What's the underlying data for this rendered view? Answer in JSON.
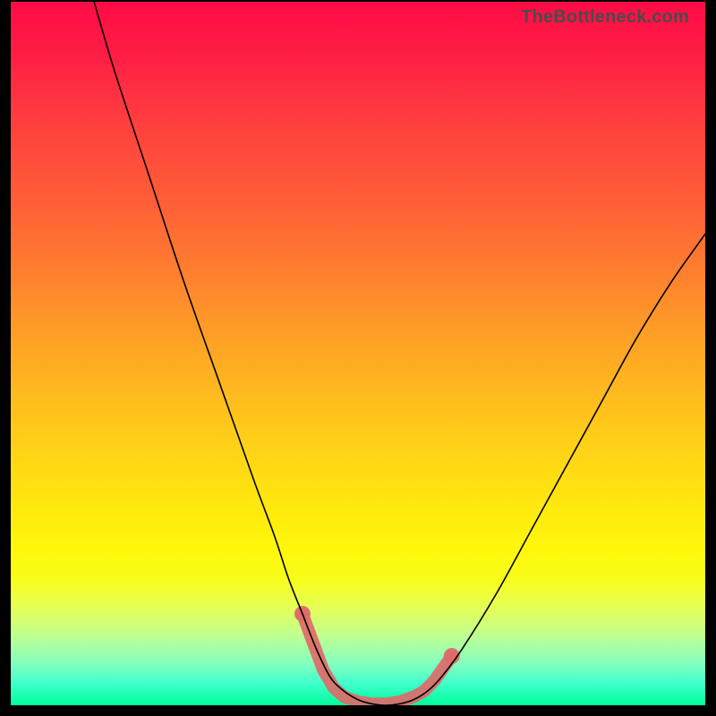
{
  "watermark": "TheBottleneck.com",
  "chart_data": {
    "type": "line",
    "title": "",
    "xlabel": "",
    "ylabel": "",
    "xlim": [
      0,
      100
    ],
    "ylim": [
      0,
      100
    ],
    "grid": false,
    "legend": false,
    "series": [
      {
        "name": "curve",
        "x": [
          12,
          15,
          20,
          25,
          30,
          35,
          38,
          40,
          42,
          44,
          46,
          48,
          50,
          52,
          54,
          56,
          58,
          60,
          62,
          65,
          70,
          75,
          80,
          85,
          90,
          95,
          100
        ],
        "values": [
          100,
          90,
          75,
          60,
          46,
          32,
          24,
          18,
          13,
          8,
          4,
          2,
          0.8,
          0.2,
          0.0,
          0.2,
          0.8,
          2,
          4,
          8,
          16,
          25,
          34,
          43,
          52,
          60,
          67
        ]
      }
    ],
    "markers": {
      "name": "bottom-markers",
      "color": "#de6a6a",
      "points": [
        {
          "x": 42.0,
          "y": 13
        },
        {
          "x": 43.5,
          "y": 9
        },
        {
          "x": 45.0,
          "y": 5
        },
        {
          "x": 46.5,
          "y": 2.5
        },
        {
          "x": 48.0,
          "y": 1.2
        },
        {
          "x": 50.0,
          "y": 0.5
        },
        {
          "x": 52.0,
          "y": 0.2
        },
        {
          "x": 54.0,
          "y": 0.2
        },
        {
          "x": 56.0,
          "y": 0.5
        },
        {
          "x": 58.0,
          "y": 1.2
        },
        {
          "x": 59.5,
          "y": 2.0
        },
        {
          "x": 61.0,
          "y": 3.5
        },
        {
          "x": 63.5,
          "y": 7.0
        }
      ]
    }
  }
}
